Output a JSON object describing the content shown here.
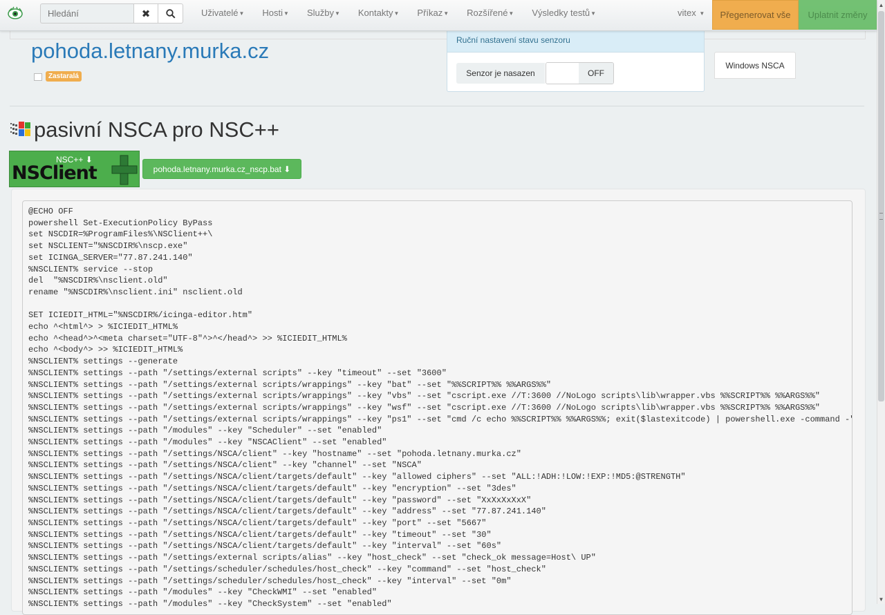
{
  "navbar": {
    "search_placeholder": "Hledání",
    "menu": [
      {
        "label": "Uživatelé"
      },
      {
        "label": "Hosti"
      },
      {
        "label": "Služby"
      },
      {
        "label": "Kontakty"
      },
      {
        "label": "Příkaz"
      },
      {
        "label": "Rozšířené"
      },
      {
        "label": "Výsledky testů"
      }
    ],
    "user": "vitex",
    "regenerate_label": "Přegenerovat vše",
    "apply_label": "Uplatnit změny"
  },
  "host": {
    "title": "pohoda.letnany.murka.cz",
    "badge": "Zastaralá"
  },
  "sensor": {
    "heading": "Ruční nastavení stavu senzoru",
    "label": "Senzor je nasazen",
    "toggle_state": "OFF"
  },
  "tabs": {
    "windows_nsca": "Windows NSCA"
  },
  "page": {
    "title": "pasivní NSCA pro NSC++"
  },
  "downloads": {
    "nsclient_link": "NSC++",
    "bat_link": "pohoda.letnany.murka.cz_nscp.bat"
  },
  "code": {
    "lines": [
      "@ECHO OFF",
      "powershell Set-ExecutionPolicy ByPass",
      "set NSCDIR=%ProgramFiles%\\NSClient++\\",
      "set NSCLIENT=\"%NSCDIR%\\nscp.exe\"",
      "set ICINGA_SERVER=\"77.87.241.140\"",
      "%NSCLIENT% service --stop",
      "del  \"%NSCDIR%\\nsclient.old\"",
      "rename \"%NSCDIR%\\nsclient.ini\" nsclient.old",
      "",
      "SET ICIEDIT_HTML=\"%NSCDIR%/icinga-editor.htm\"",
      "echo ^<html^> > %ICIEDIT_HTML%",
      "echo ^<head^>^<meta charset=\"UTF-8\"^>^</head^> >> %ICIEDIT_HTML%",
      "echo ^<body^> >> %ICIEDIT_HTML%",
      "%NSCLIENT% settings --generate",
      "%NSCLIENT% settings --path \"/settings/external scripts\" --key \"timeout\" --set \"3600\"",
      "%NSCLIENT% settings --path \"/settings/external scripts/wrappings\" --key \"bat\" --set \"%%SCRIPT%% %%ARGS%%\"",
      "%NSCLIENT% settings --path \"/settings/external scripts/wrappings\" --key \"vbs\" --set \"cscript.exe //T:3600 //NoLogo scripts\\lib\\wrapper.vbs %%SCRIPT%% %%ARGS%%\"",
      "%NSCLIENT% settings --path \"/settings/external scripts/wrappings\" --key \"wsf\" --set \"cscript.exe //T:3600 //NoLogo scripts\\lib\\wrapper.vbs %%SCRIPT%% %%ARGS%%\"",
      "%NSCLIENT% settings --path \"/settings/external scripts/wrappings\" --key \"ps1\" --set \"cmd /c echo %%SCRIPT%% %%ARGS%%; exit($lastexitcode) | powershell.exe -command -\"",
      "%NSCLIENT% settings --path \"/modules\" --key \"Scheduler\" --set \"enabled\"",
      "%NSCLIENT% settings --path \"/modules\" --key \"NSCAClient\" --set \"enabled\"",
      "%NSCLIENT% settings --path \"/settings/NSCA/client\" --key \"hostname\" --set \"pohoda.letnany.murka.cz\"",
      "%NSCLIENT% settings --path \"/settings/NSCA/client\" --key \"channel\" --set \"NSCA\"",
      "%NSCLIENT% settings --path \"/settings/NSCA/client/targets/default\" --key \"allowed ciphers\" --set \"ALL:!ADH:!LOW:!EXP:!MD5:@STRENGTH\"",
      "%NSCLIENT% settings --path \"/settings/NSCA/client/targets/default\" --key \"encryption\" --set \"3des\"",
      "%NSCLIENT% settings --path \"/settings/NSCA/client/targets/default\" --key \"password\" --set \"XxXxXxXxX\"",
      "%NSCLIENT% settings --path \"/settings/NSCA/client/targets/default\" --key \"address\" --set \"77.87.241.140\"",
      "%NSCLIENT% settings --path \"/settings/NSCA/client/targets/default\" --key \"port\" --set \"5667\"",
      "%NSCLIENT% settings --path \"/settings/NSCA/client/targets/default\" --key \"timeout\" --set \"30\"",
      "%NSCLIENT% settings --path \"/settings/NSCA/client/targets/default\" --key \"interval\" --set \"60s\"",
      "%NSCLIENT% settings --path \"/settings/external scripts/alias\" --key \"host_check\" --set \"check_ok message=Host\\ UP\"",
      "%NSCLIENT% settings --path \"/settings/scheduler/schedules/host_check\" --key \"command\" --set \"host_check\"",
      "%NSCLIENT% settings --path \"/settings/scheduler/schedules/host_check\" --key \"interval\" --set \"0m\"",
      "%NSCLIENT% settings --path \"/modules\" --key \"CheckWMI\" --set \"enabled\"",
      "%NSCLIENT% settings --path \"/modules\" --key \"CheckSystem\" --set \"enabled\""
    ]
  }
}
